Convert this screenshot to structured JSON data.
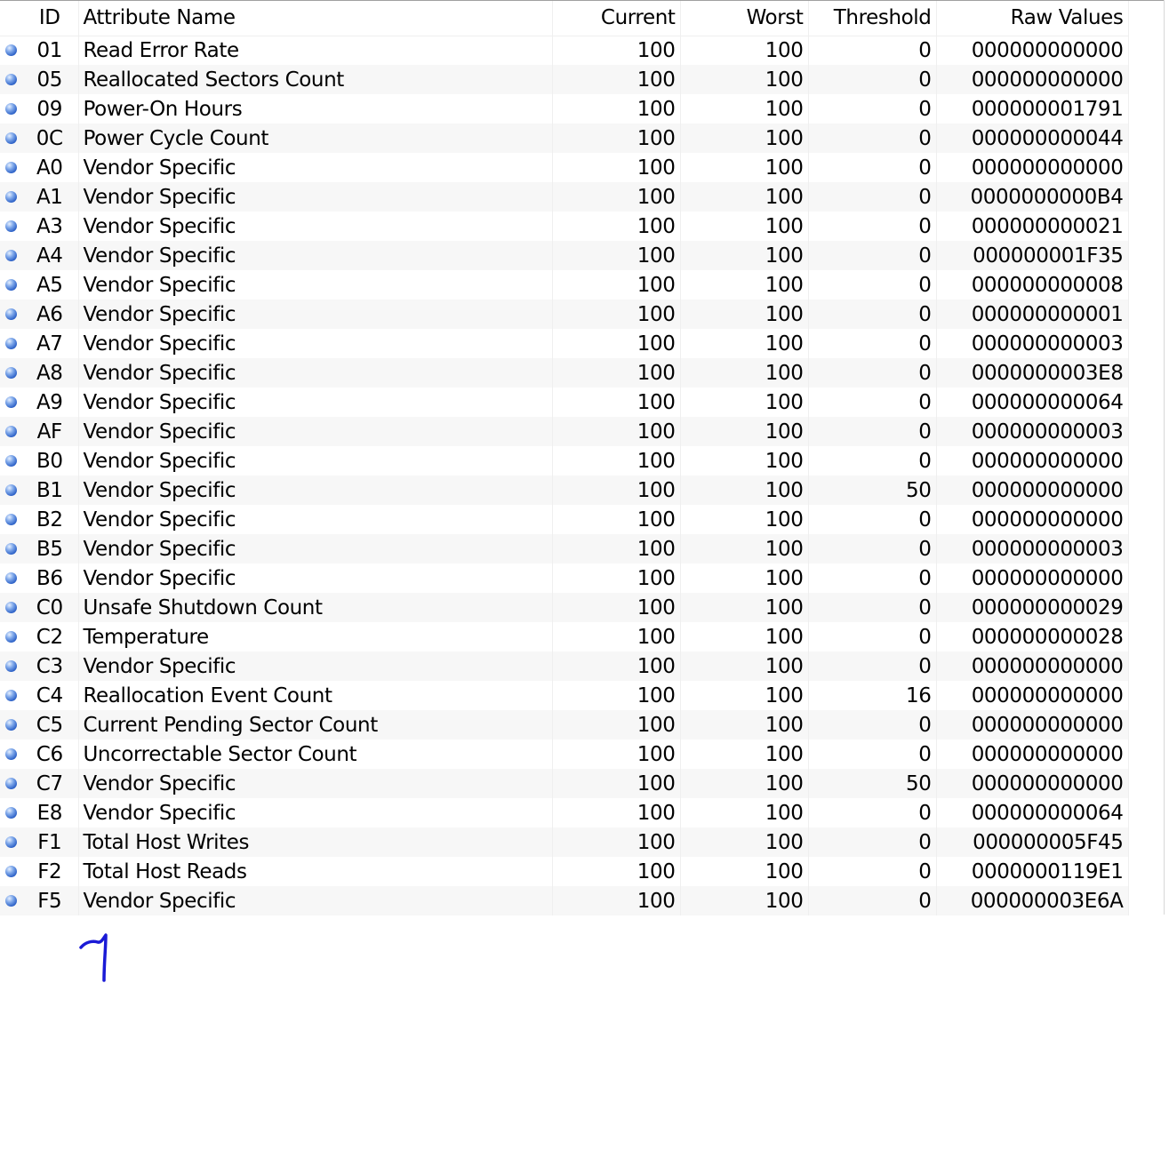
{
  "table": {
    "columns": {
      "id": "ID",
      "name": "Attribute Name",
      "current": "Current",
      "worst": "Worst",
      "threshold": "Threshold",
      "raw": "Raw Values"
    },
    "rows": [
      {
        "id": "01",
        "name": "Read Error Rate",
        "current": "100",
        "worst": "100",
        "threshold": "0",
        "raw": "000000000000"
      },
      {
        "id": "05",
        "name": "Reallocated Sectors Count",
        "current": "100",
        "worst": "100",
        "threshold": "0",
        "raw": "000000000000"
      },
      {
        "id": "09",
        "name": "Power-On Hours",
        "current": "100",
        "worst": "100",
        "threshold": "0",
        "raw": "000000001791"
      },
      {
        "id": "0C",
        "name": "Power Cycle Count",
        "current": "100",
        "worst": "100",
        "threshold": "0",
        "raw": "000000000044"
      },
      {
        "id": "A0",
        "name": "Vendor Specific",
        "current": "100",
        "worst": "100",
        "threshold": "0",
        "raw": "000000000000"
      },
      {
        "id": "A1",
        "name": "Vendor Specific",
        "current": "100",
        "worst": "100",
        "threshold": "0",
        "raw": "0000000000B4"
      },
      {
        "id": "A3",
        "name": "Vendor Specific",
        "current": "100",
        "worst": "100",
        "threshold": "0",
        "raw": "000000000021"
      },
      {
        "id": "A4",
        "name": "Vendor Specific",
        "current": "100",
        "worst": "100",
        "threshold": "0",
        "raw": "000000001F35"
      },
      {
        "id": "A5",
        "name": "Vendor Specific",
        "current": "100",
        "worst": "100",
        "threshold": "0",
        "raw": "000000000008"
      },
      {
        "id": "A6",
        "name": "Vendor Specific",
        "current": "100",
        "worst": "100",
        "threshold": "0",
        "raw": "000000000001"
      },
      {
        "id": "A7",
        "name": "Vendor Specific",
        "current": "100",
        "worst": "100",
        "threshold": "0",
        "raw": "000000000003"
      },
      {
        "id": "A8",
        "name": "Vendor Specific",
        "current": "100",
        "worst": "100",
        "threshold": "0",
        "raw": "0000000003E8"
      },
      {
        "id": "A9",
        "name": "Vendor Specific",
        "current": "100",
        "worst": "100",
        "threshold": "0",
        "raw": "000000000064"
      },
      {
        "id": "AF",
        "name": "Vendor Specific",
        "current": "100",
        "worst": "100",
        "threshold": "0",
        "raw": "000000000003"
      },
      {
        "id": "B0",
        "name": "Vendor Specific",
        "current": "100",
        "worst": "100",
        "threshold": "0",
        "raw": "000000000000"
      },
      {
        "id": "B1",
        "name": "Vendor Specific",
        "current": "100",
        "worst": "100",
        "threshold": "50",
        "raw": "000000000000"
      },
      {
        "id": "B2",
        "name": "Vendor Specific",
        "current": "100",
        "worst": "100",
        "threshold": "0",
        "raw": "000000000000"
      },
      {
        "id": "B5",
        "name": "Vendor Specific",
        "current": "100",
        "worst": "100",
        "threshold": "0",
        "raw": "000000000003"
      },
      {
        "id": "B6",
        "name": "Vendor Specific",
        "current": "100",
        "worst": "100",
        "threshold": "0",
        "raw": "000000000000"
      },
      {
        "id": "C0",
        "name": "Unsafe Shutdown Count",
        "current": "100",
        "worst": "100",
        "threshold": "0",
        "raw": "000000000029"
      },
      {
        "id": "C2",
        "name": "Temperature",
        "current": "100",
        "worst": "100",
        "threshold": "0",
        "raw": "000000000028"
      },
      {
        "id": "C3",
        "name": "Vendor Specific",
        "current": "100",
        "worst": "100",
        "threshold": "0",
        "raw": "000000000000"
      },
      {
        "id": "C4",
        "name": "Reallocation Event Count",
        "current": "100",
        "worst": "100",
        "threshold": "16",
        "raw": "000000000000"
      },
      {
        "id": "C5",
        "name": "Current Pending Sector Count",
        "current": "100",
        "worst": "100",
        "threshold": "0",
        "raw": "000000000000"
      },
      {
        "id": "C6",
        "name": "Uncorrectable Sector Count",
        "current": "100",
        "worst": "100",
        "threshold": "0",
        "raw": "000000000000"
      },
      {
        "id": "C7",
        "name": "Vendor Specific",
        "current": "100",
        "worst": "100",
        "threshold": "50",
        "raw": "000000000000"
      },
      {
        "id": "E8",
        "name": "Vendor Specific",
        "current": "100",
        "worst": "100",
        "threshold": "0",
        "raw": "000000000064"
      },
      {
        "id": "F1",
        "name": "Total Host Writes",
        "current": "100",
        "worst": "100",
        "threshold": "0",
        "raw": "000000005F45"
      },
      {
        "id": "F2",
        "name": "Total Host Reads",
        "current": "100",
        "worst": "100",
        "threshold": "0",
        "raw": "0000000119E1"
      },
      {
        "id": "F5",
        "name": "Vendor Specific",
        "current": "100",
        "worst": "100",
        "threshold": "0",
        "raw": "000000003E6A"
      }
    ]
  },
  "status_icon": {
    "name": "status-dot-icon",
    "color": "#3a6fd8"
  },
  "annotation": {
    "name": "handwritten-mark-icon",
    "color": "#1a1ad6"
  }
}
